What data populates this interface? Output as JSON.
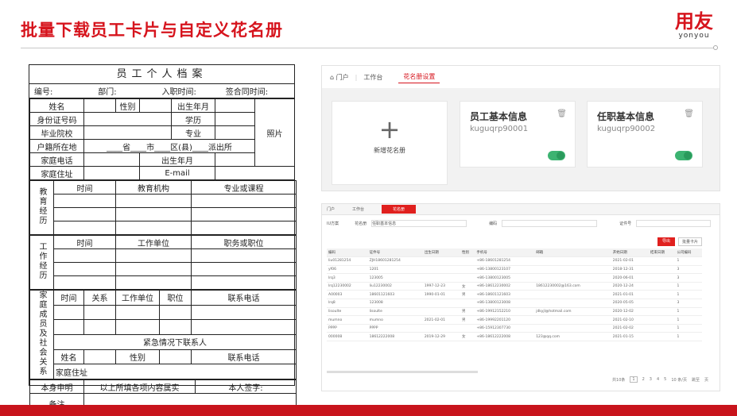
{
  "slide": {
    "title": "批量下载员工卡片与自定义花名册"
  },
  "logo": {
    "cn": "用友",
    "en": "yonyou"
  },
  "form": {
    "title": "员工个人档案",
    "meta": [
      "编号:",
      "部门:",
      "入职时间:",
      "签合同时间:"
    ],
    "row_name": [
      "姓名",
      "",
      "性别",
      "",
      "出生年月",
      ""
    ],
    "photo": "照片",
    "row_id": [
      "身份证号码",
      "学历"
    ],
    "row_school": [
      "毕业院校",
      "专业"
    ],
    "row_hukou": [
      "户籍所在地",
      "____省____市____区(县)____派出所"
    ],
    "row_phone": [
      "家庭电话",
      "出生年月"
    ],
    "row_addr": [
      "家庭住址",
      "E-mail"
    ],
    "edu_side": "教育经历",
    "edu_head": [
      "时间",
      "教育机构",
      "专业或课程"
    ],
    "work_side": "工作经历",
    "work_head": [
      "时间",
      "工作单位",
      "职务或职位"
    ],
    "family_side": "家庭成员及社会关系",
    "family_head": [
      "时间",
      "关系",
      "工作单位",
      "职位",
      "联系电话"
    ],
    "emergency": "紧急情况下联系人",
    "emg_row": [
      "姓名",
      "性别",
      "联系电话"
    ],
    "emg_addr": "家庭住址",
    "declare": [
      "本身申明",
      "以上所填各项内容属实",
      "本人签字:"
    ],
    "remark": "备注"
  },
  "panel1": {
    "nav": [
      "门户",
      "工作台",
      "花名册设置"
    ],
    "new_label": "新增花名册",
    "cards": [
      {
        "title": "员工基本信息",
        "code": "kuguqrp90001"
      },
      {
        "title": "任职基本信息",
        "code": "kuguqrp90002"
      }
    ]
  },
  "panel2": {
    "nav": [
      "门户",
      "工作台",
      "花名册"
    ],
    "filter": [
      "IU方案",
      "花名册",
      "任职基本信息",
      "编码",
      "证件号"
    ],
    "btns": [
      "导出",
      "批量卡片"
    ],
    "headers": [
      "编码",
      "证件号",
      "出生日期",
      "性别",
      "手机号",
      "邮箱",
      "开始日期",
      "结束日期",
      "公司编码"
    ],
    "rows": [
      [
        "liu01281254",
        "ZJH18601281254",
        "",
        "",
        "+86-18601281254",
        "",
        "2021-02-01",
        "",
        "1"
      ],
      [
        "yf06",
        "1201",
        "",
        "",
        "+86-13800123107",
        "",
        "2018-12-31",
        "",
        "3"
      ],
      [
        "lrq3",
        "123005",
        "",
        "",
        "+86-13800123005",
        "",
        "2020-06-01",
        "",
        "3"
      ],
      [
        "lrq12230002",
        "liu12230002",
        "1997-12-23",
        "女",
        "+86-18612230002",
        "18612230002@163.com",
        "2020-12-24",
        "",
        "1"
      ],
      [
        "A00003",
        "18601121603",
        "1990-01-01",
        "男",
        "+86-18601121603",
        "",
        "2021-01-01",
        "",
        "1"
      ],
      [
        "lrq8",
        "123008",
        "",
        "",
        "+86-13800123008",
        "",
        "2020-05-05",
        "",
        "3"
      ],
      [
        "lisoulte",
        "lisoulte",
        "",
        "男",
        "+86-19912152210",
        "jdkyjl@hotmail.com",
        "2020-12-02",
        "",
        "1"
      ],
      [
        "mumno",
        "mumno",
        "2021-02-01",
        "男",
        "+86-19992201120",
        "",
        "2021-02-10",
        "",
        "1"
      ],
      [
        "PPPP",
        "PPPP",
        "",
        "",
        "+86-15912307730",
        "",
        "2021-02-02",
        "",
        "1"
      ],
      [
        "000008",
        "18612222008",
        "2019-12-29",
        "女",
        "+86-18612222008",
        "123@qq.com",
        "2021-01-15",
        "",
        "1"
      ]
    ],
    "pager": [
      "共10条",
      "1",
      "2",
      "3",
      "4",
      "5",
      "10 条/页",
      "跳至",
      "页"
    ]
  }
}
